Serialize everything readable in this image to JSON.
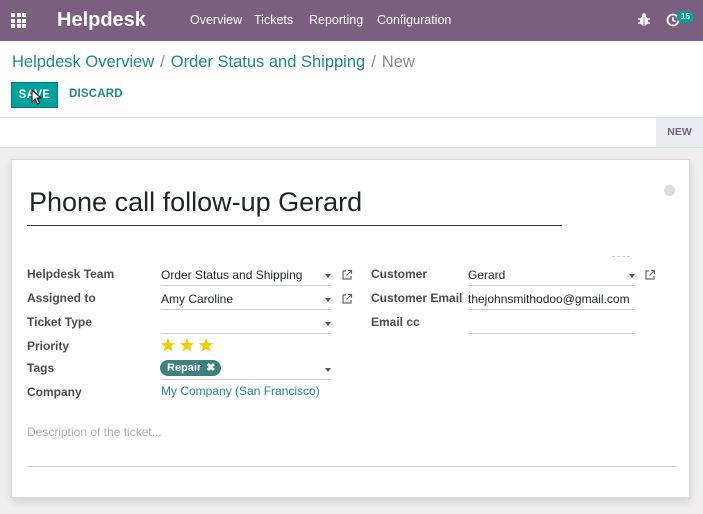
{
  "navbar": {
    "app_name": "Helpdesk",
    "menu": [
      "Overview",
      "Tickets",
      "Reporting",
      "Configuration"
    ],
    "activity_count": "15",
    "bg_color": "#7c5f80"
  },
  "breadcrumb": {
    "item1": "Helpdesk Overview",
    "item2": "Order Status and Shipping",
    "current": "New",
    "separator": "/"
  },
  "buttons": {
    "save": "SAVE",
    "discard": "DISCARD"
  },
  "status": {
    "stage": "NEW"
  },
  "form": {
    "title": "Phone call follow-up Gerard",
    "left": {
      "team_label": "Helpdesk Team",
      "team_value": "Order Status and Shipping",
      "assigned_label": "Assigned to",
      "assigned_value": "Amy Caroline",
      "type_label": "Ticket Type",
      "type_value": "",
      "priority_label": "Priority",
      "priority_stars": 3,
      "priority_max": 3,
      "tags_label": "Tags",
      "tag": "Repair",
      "company_label": "Company",
      "company_value": "My Company (San Francisco)"
    },
    "right": {
      "customer_label": "Customer",
      "customer_value": "Gerard",
      "email_label": "Customer Email",
      "email_value": "thejohnsmithodoo@gmail.com",
      "cc_label": "Email cc",
      "cc_value": ""
    },
    "description_placeholder": "Description of the ticket..."
  },
  "colors": {
    "accent": "#00a09d",
    "link": "#1f8a85",
    "star": "#f3cc00"
  }
}
